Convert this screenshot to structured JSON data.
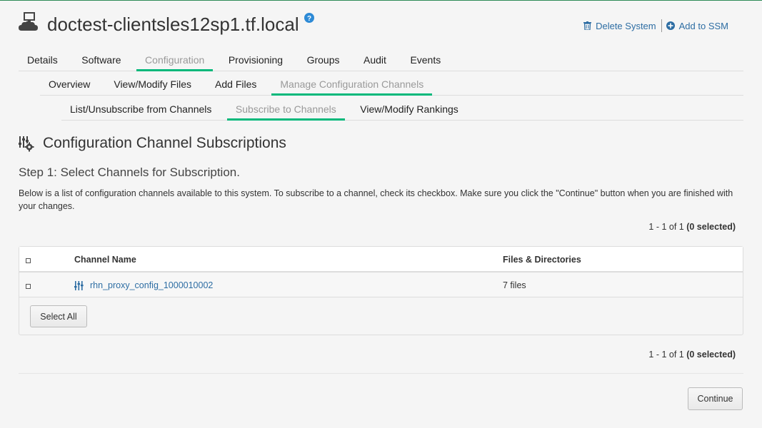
{
  "header": {
    "title": "doctest-clientsles12sp1.tf.local",
    "system_icon": "cloud-monitor-icon",
    "help_icon": "question-circle-icon",
    "actions": [
      {
        "label": "Delete System",
        "icon": "trash-icon"
      },
      {
        "label": "Add to SSM",
        "icon": "plus-circle-icon"
      }
    ]
  },
  "tabs_level1": [
    {
      "label": "Details",
      "active": false
    },
    {
      "label": "Software",
      "active": false
    },
    {
      "label": "Configuration",
      "active": true
    },
    {
      "label": "Provisioning",
      "active": false
    },
    {
      "label": "Groups",
      "active": false
    },
    {
      "label": "Audit",
      "active": false
    },
    {
      "label": "Events",
      "active": false
    }
  ],
  "tabs_level2": [
    {
      "label": "Overview",
      "active": false
    },
    {
      "label": "View/Modify Files",
      "active": false
    },
    {
      "label": "Add Files",
      "active": false
    },
    {
      "label": "Manage Configuration Channels",
      "active": true
    }
  ],
  "tabs_level3": [
    {
      "label": "List/Unsubscribe from Channels",
      "active": false
    },
    {
      "label": "Subscribe to Channels",
      "active": true
    },
    {
      "label": "View/Modify Rankings",
      "active": false
    }
  ],
  "section": {
    "title": "Configuration Channel Subscriptions",
    "icon": "config-channel-gear-icon"
  },
  "step": {
    "title": "Step 1: Select Channels for Subscription.",
    "description": "Below is a list of configuration channels available to this system. To subscribe to a channel, check its checkbox. Make sure you click the \"Continue\" button when you are finished with your changes."
  },
  "pager": {
    "range": "1 - 1 of 1 ",
    "selected": "(0 selected)"
  },
  "table": {
    "columns": [
      "Channel Name",
      "Files & Directories"
    ],
    "rows": [
      {
        "name": "rhn_proxy_config_1000010002",
        "files": "7 files",
        "icon": "config-channel-icon"
      }
    ],
    "select_all_label": "Select All"
  },
  "continue_label": "Continue",
  "colors": {
    "accent": "#00b87a",
    "link": "#2d6da3",
    "inactive_tab": "#999999"
  }
}
